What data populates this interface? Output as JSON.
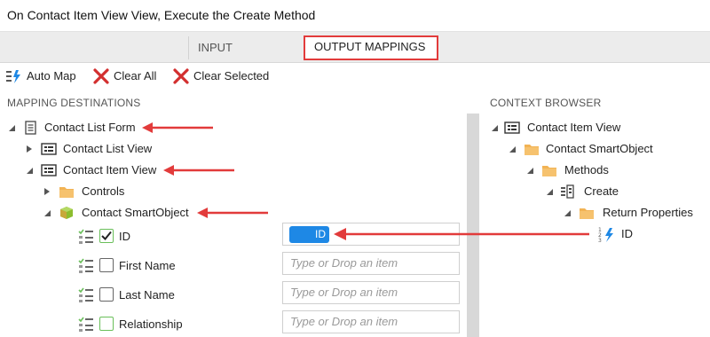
{
  "window": {
    "title": "On Contact Item View View, Execute the Create Method"
  },
  "tabs": [
    {
      "label": "INPUT MAPPINGS"
    },
    {
      "label": "OUTPUT MAPPINGS"
    }
  ],
  "toolbar": {
    "auto_map": "Auto Map",
    "clear_all": "Clear All",
    "clear_selected": "Clear Selected"
  },
  "left_pane": {
    "header": "MAPPING DESTINATIONS",
    "tree": {
      "root": "Contact List Form",
      "list_view": "Contact List View",
      "item_view": "Contact Item View",
      "controls": "Controls",
      "smartobject": "Contact SmartObject"
    },
    "properties": [
      {
        "label": "ID",
        "checked": true,
        "mapped": "ID",
        "placeholder": ""
      },
      {
        "label": "First Name",
        "checked": false,
        "mapped": "",
        "placeholder": "Type or Drop an item"
      },
      {
        "label": "Last Name",
        "checked": false,
        "mapped": "",
        "placeholder": "Type or Drop an item"
      },
      {
        "label": "Relationship",
        "checked": false,
        "mapped": "",
        "placeholder": "Type or Drop an item"
      }
    ]
  },
  "right_pane": {
    "header": "CONTEXT BROWSER",
    "tree": {
      "item_view": "Contact Item View",
      "smartobject": "Contact SmartObject",
      "methods": "Methods",
      "create": "Create",
      "return_properties": "Return Properties",
      "id": "ID"
    }
  },
  "colors": {
    "highlight": "#e23b3b",
    "chip": "#1e88e5",
    "folder": "#f2b354",
    "smartobject": "#8cbd2e"
  }
}
